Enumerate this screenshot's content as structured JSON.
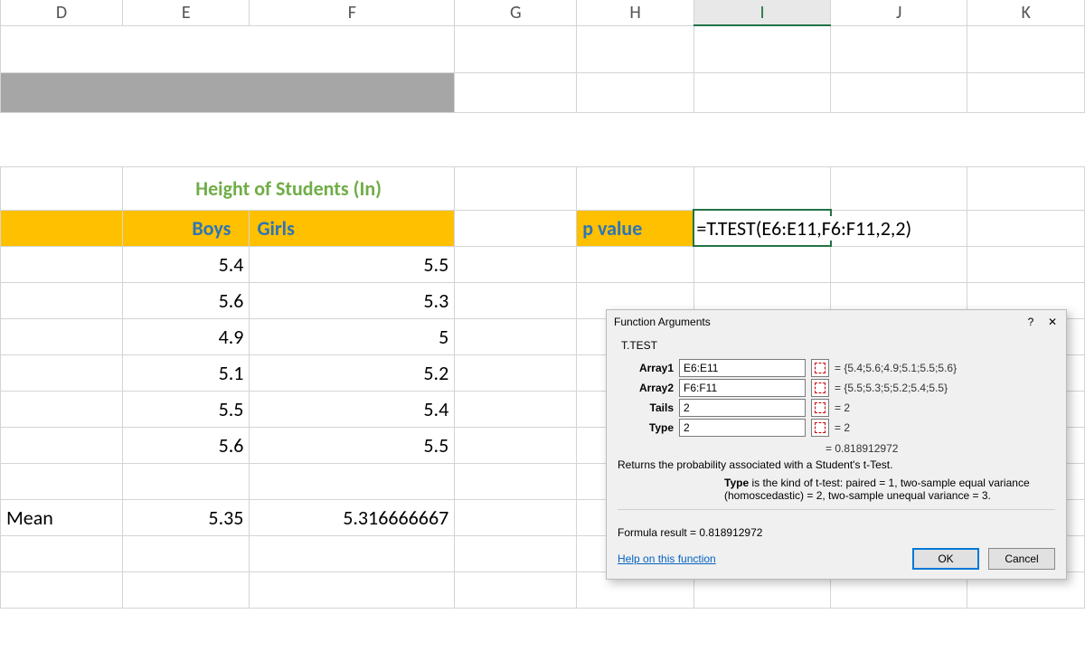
{
  "columns": [
    "D",
    "E",
    "F",
    "G",
    "H",
    "I",
    "J",
    "K"
  ],
  "selected_col": "I",
  "title": "T-TEST",
  "table_title": "Height of Students (In)",
  "headers": {
    "boys": "Boys",
    "girls": "Girls"
  },
  "data": {
    "boys": [
      "5.4",
      "5.6",
      "4.9",
      "5.1",
      "5.5",
      "5.6"
    ],
    "girls": [
      "5.5",
      "5.3",
      "5",
      "5.2",
      "5.4",
      "5.5"
    ]
  },
  "mean_label": "Mean",
  "mean": {
    "boys": "5.35",
    "girls": "5.316666667"
  },
  "pvalue_label": "p value",
  "formula": "=T.TEST(E6:E11,F6:F11,2,2)",
  "dialog": {
    "title": "Function Arguments",
    "fn": "T.TEST",
    "args": [
      {
        "label": "Array1",
        "val": "E6:E11",
        "res": "=  {5.4;5.6;4.9;5.1;5.5;5.6}"
      },
      {
        "label": "Array2",
        "val": "F6:F11",
        "res": "=  {5.5;5.3;5;5.2;5.4;5.5}"
      },
      {
        "label": "Tails",
        "val": "2",
        "res": "=  2"
      },
      {
        "label": "Type",
        "val": "2",
        "res": "=  2"
      }
    ],
    "calc_pre": "=  ",
    "calc": "0.818912972",
    "desc1": "Returns the probability associated with a Student's t-Test.",
    "desc2_b": "Type",
    "desc2": "  is the kind of t-test: paired = 1, two-sample equal variance (homoscedastic) = 2, two-sample unequal variance = 3.",
    "formula_result_label": "Formula result =  ",
    "formula_result": "0.818912972",
    "help": "Help on this function",
    "ok": "OK",
    "cancel": "Cancel"
  }
}
